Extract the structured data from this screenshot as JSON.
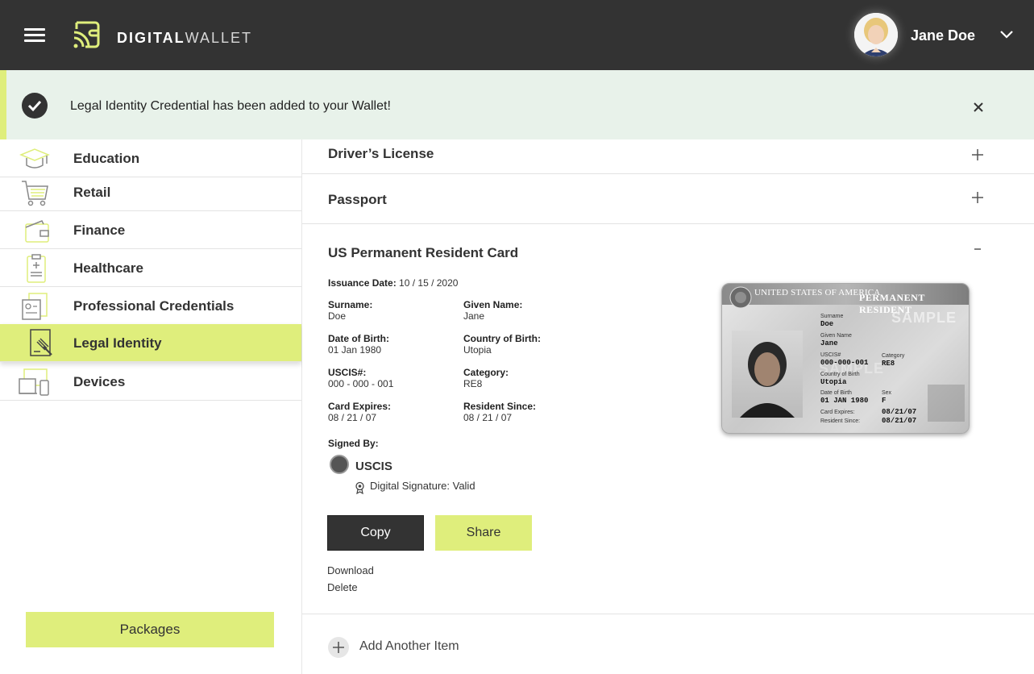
{
  "header": {
    "brand_bold": "DIGITAL",
    "brand_light": "WALLET",
    "user_name": "Jane Doe",
    "icons": {
      "menu": "hamburger-icon",
      "logo": "wallet-signal-icon",
      "user_menu": "chevron-down-icon"
    }
  },
  "notification": {
    "message": "Legal Identity Credential has been added to your Wallet!",
    "icons": {
      "status": "check-circle-icon",
      "dismiss": "close-icon"
    }
  },
  "sidebar": {
    "items": [
      {
        "label": "Education",
        "icon": "graduation-cap-icon",
        "active": false
      },
      {
        "label": "Retail",
        "icon": "shopping-cart-icon",
        "active": false
      },
      {
        "label": "Finance",
        "icon": "wallet-icon",
        "active": false
      },
      {
        "label": "Healthcare",
        "icon": "clipboard-medical-icon",
        "active": false
      },
      {
        "label": "Professional Credentials",
        "icon": "id-badge-icon",
        "active": false
      },
      {
        "label": "Legal Identity",
        "icon": "gavel-document-icon",
        "active": true
      },
      {
        "label": "Devices",
        "icon": "devices-icon",
        "active": false
      }
    ],
    "packages_label": "Packages"
  },
  "accent_color": "#dfee7c",
  "main": {
    "sections": [
      {
        "title": "Driver’s License",
        "expanded": false
      },
      {
        "title": "Passport",
        "expanded": false
      },
      {
        "title": "US Permanent Resident Card",
        "expanded": true
      }
    ],
    "credential": {
      "issuance_label": "Issuance Date:",
      "issuance_value": "10 / 15 / 2020",
      "fields": [
        {
          "label": "Surname:",
          "value": "Doe"
        },
        {
          "label": "Given Name:",
          "value": "Jane"
        },
        {
          "label": "Date of Birth:",
          "value": "01 Jan 1980"
        },
        {
          "label": "Country of Birth:",
          "value": "Utopia"
        },
        {
          "label": "USCIS#:",
          "value": "000 - 000 - 001"
        },
        {
          "label": "Category:",
          "value": "RE8"
        },
        {
          "label": "Card Expires:",
          "value": "08 / 21 / 07"
        },
        {
          "label": "Resident Since:",
          "value": "08 / 21 / 07"
        }
      ],
      "signed_by_label": "Signed By:",
      "signer_name": "USCIS",
      "signature_status": "Digital Signature: Valid",
      "copy_label": "Copy",
      "share_label": "Share",
      "download_label": "Download",
      "delete_label": "Delete"
    },
    "card_image": {
      "country": "UNITED STATES OF AMERICA",
      "type": "PERMANENT RESIDENT",
      "watermark": "SAMPLE",
      "surname_label": "Surname",
      "surname": "Doe",
      "given_label": "Given Name",
      "given": "Jane",
      "uscis_label": "USCIS#",
      "uscis": "000-000-001",
      "category_label": "Category",
      "category": "RE8",
      "country_birth_label": "Country of Birth",
      "country_birth": "Utopia",
      "dob_label": "Date of Birth",
      "dob": "01 JAN 1980",
      "sex_label": "Sex",
      "sex": "F",
      "expires_label": "Card Expires:",
      "expires": "08/21/07",
      "resident_label": "Resident Since:",
      "resident": "08/21/07"
    },
    "add_item_label": "Add Another Item"
  }
}
